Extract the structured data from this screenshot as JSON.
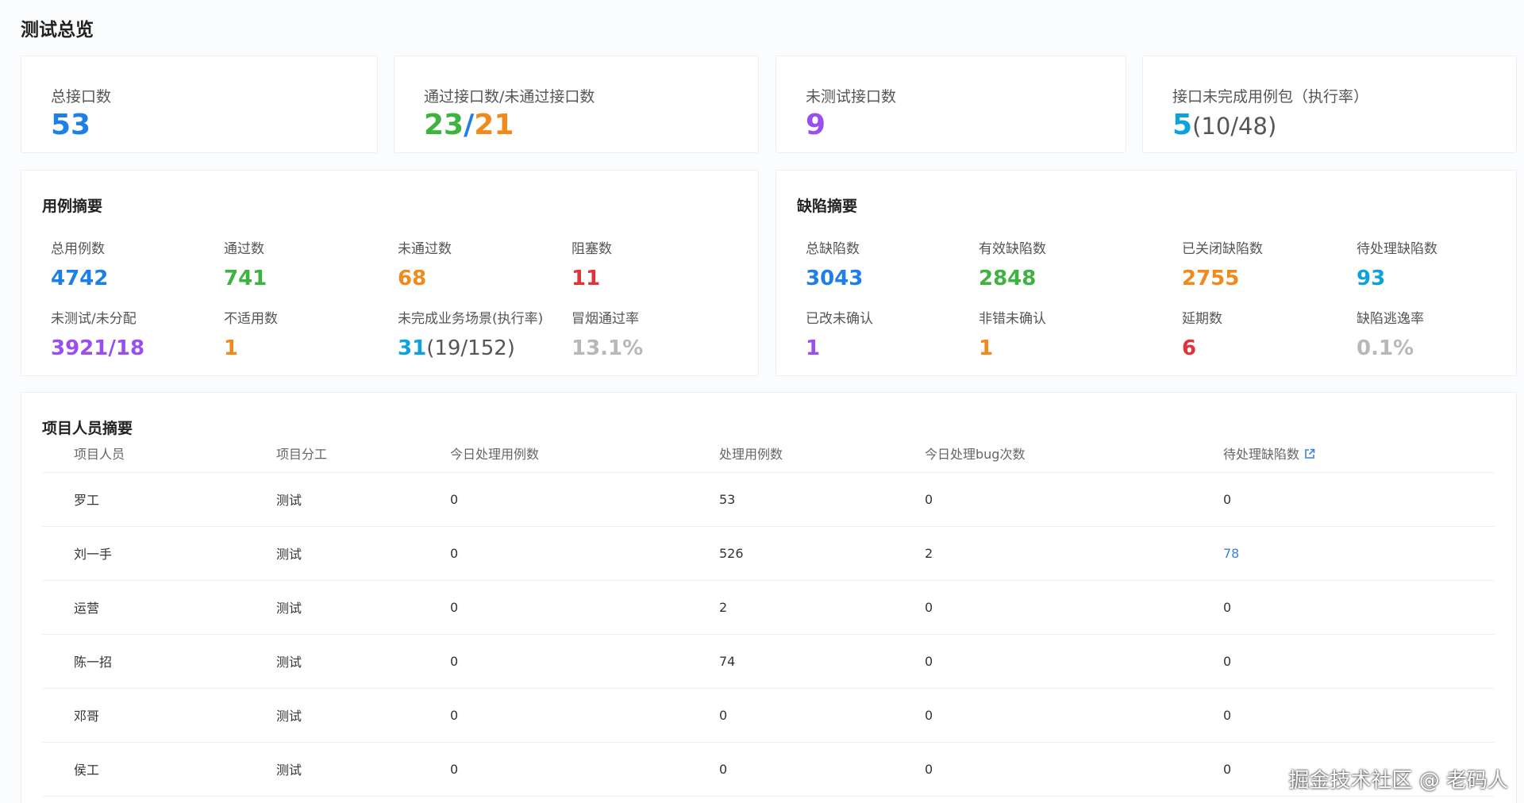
{
  "page_title": "测试总览",
  "top_cards": {
    "total_interfaces": {
      "label": "总接口数",
      "value": "53"
    },
    "pass_fail_interfaces": {
      "label": "通过接口数/未通过接口数",
      "pass": "23",
      "sep": "/",
      "fail": "21"
    },
    "untested_interfaces": {
      "label": "未测试接口数",
      "value": "9"
    },
    "incomplete_packages": {
      "label": "接口未完成用例包（执行率）",
      "value": "5",
      "sub": "(10/48)"
    }
  },
  "case_summary": {
    "title": "用例摘要",
    "total": {
      "label": "总用例数",
      "value": "4742"
    },
    "passed": {
      "label": "通过数",
      "value": "741"
    },
    "failed": {
      "label": "未通过数",
      "value": "68"
    },
    "blocked": {
      "label": "阻塞数",
      "value": "11"
    },
    "untested": {
      "label": "未测试/未分配",
      "value": "3921/18"
    },
    "not_applicable": {
      "label": "不适用数",
      "value": "1"
    },
    "incomplete_scenarios": {
      "label": "未完成业务场景(执行率)",
      "value": "31",
      "sub": "(19/152)"
    },
    "smoke_pass_rate": {
      "label": "冒烟通过率",
      "value": "13.1%"
    }
  },
  "defect_summary": {
    "title": "缺陷摘要",
    "total": {
      "label": "总缺陷数",
      "value": "3043"
    },
    "valid": {
      "label": "有效缺陷数",
      "value": "2848"
    },
    "closed": {
      "label": "已关闭缺陷数",
      "value": "2755"
    },
    "pending": {
      "label": "待处理缺陷数",
      "value": "93"
    },
    "fixed_unconfirmed": {
      "label": "已改未确认",
      "value": "1"
    },
    "not_bug_unconfirmed": {
      "label": "非错未确认",
      "value": "1"
    },
    "postponed": {
      "label": "延期数",
      "value": "6"
    },
    "escape_rate": {
      "label": "缺陷逃逸率",
      "value": "0.1%"
    }
  },
  "people_summary": {
    "title": "项目人员摘要",
    "columns": [
      "项目人员",
      "项目分工",
      "今日处理用例数",
      "处理用例数",
      "今日处理bug次数",
      "待处理缺陷数"
    ],
    "rows": [
      [
        "罗工",
        "测试",
        "0",
        "53",
        "0",
        "0"
      ],
      [
        "刘一手",
        "测试",
        "0",
        "526",
        "2",
        "78"
      ],
      [
        "运营",
        "测试",
        "0",
        "2",
        "0",
        "0"
      ],
      [
        "陈一招",
        "测试",
        "0",
        "74",
        "0",
        "0"
      ],
      [
        "邓哥",
        "测试",
        "0",
        "0",
        "0",
        "0"
      ],
      [
        "侯工",
        "测试",
        "0",
        "0",
        "0",
        "0"
      ]
    ]
  },
  "watermark": "掘金技术社区 @ 老码人",
  "icons": {
    "external_link": "external-link-icon"
  },
  "colors": {
    "blue": "#1e7fe6",
    "green": "#3fb33f",
    "orange": "#f08a1c",
    "purple": "#9b4ef0",
    "red": "#e0333a",
    "cyan": "#0ea2dc",
    "grey": "#b8b8b8",
    "link": "#3e7fe2"
  }
}
